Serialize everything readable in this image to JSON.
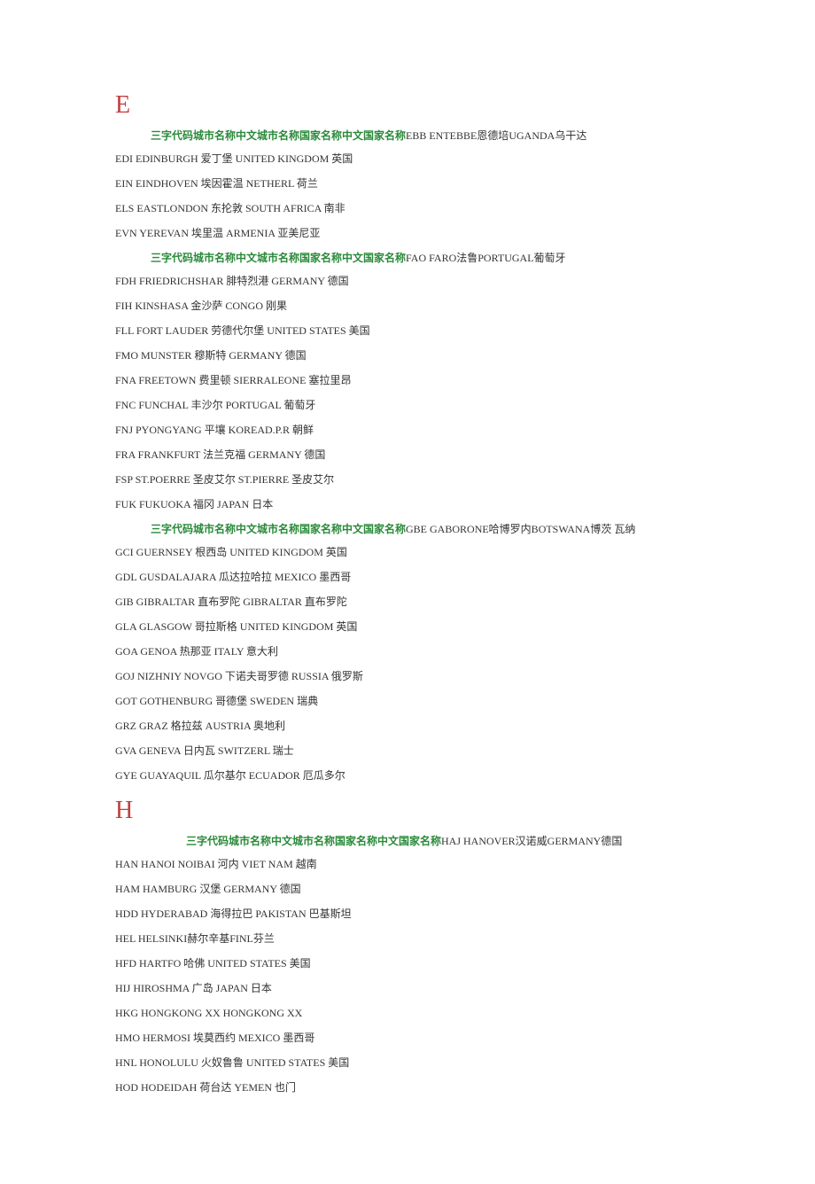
{
  "sections": [
    {
      "letter": "E",
      "header": {
        "green": "三字代码城市名称中文城市名称国家名称中文国家名称",
        "tail": "EBB ENTEBBE恩德培UGANDA乌干达"
      },
      "entries": [
        "EDI EDINBURGH 爱丁堡 UNITED KINGDOM 英国",
        "EIN EINDHOVEN 埃因霍温 NETHERL 荷兰",
        "ELS EASTLONDON 东抡敦 SOUTH AFRICA 南非",
        "EVN YEREVAN 埃里温 ARMENIA 亚美尼亚"
      ]
    },
    {
      "letter": "",
      "header": {
        "green": "三字代码城市名称中文城市名称国家名称中文国家名称",
        "tail": "FAO FARO法鲁PORTUGAL葡萄牙"
      },
      "entries": [
        "FDH FRIEDRICHSHAR 腓特烈港 GERMANY 德国",
        "FIH KINSHASA 金沙萨 CONGO 刚果",
        "FLL FORT LAUDER 劳德代尔堡 UNITED STATES 美国",
        "FMO MUNSTER 穆斯特 GERMANY 德国",
        "FNA FREETOWN 费里顿 SIERRALEONE 塞拉里昂",
        "FNC FUNCHAL 丰沙尔 PORTUGAL 葡萄牙",
        "FNJ PYONGYANG 平壤 KOREAD.P.R 朝鲜",
        "FRA FRANKFURT 法兰克福 GERMANY 德国",
        "FSP ST.POERRE 圣皮艾尔 ST.PIERRE 圣皮艾尔",
        "FUK FUKUOKA 福冈 JAPAN 日本"
      ]
    },
    {
      "letter": "",
      "header": {
        "green": "三字代码城市名称中文城市名称国家名称中文国家名称",
        "tail": "GBE GABORONE哈博罗内BOTSWANA博茨 瓦纳"
      },
      "entries": [
        "GCI GUERNSEY 根西岛 UNITED KINGDOM 英国",
        "GDL GUSDALAJARA 瓜达拉哈拉 MEXICO 墨西哥",
        "GIB GIBRALTAR 直布罗陀 GIBRALTAR 直布罗陀",
        "GLA GLASGOW 哥拉斯格 UNITED KINGDOM 英国",
        "GOA GENOA 热那亚 ITALY 意大利",
        "GOJ NIZHNIY NOVGO 下诺夫哥罗德 RUSSIA 俄罗斯",
        "GOT GOTHENBURG 哥德堡 SWEDEN 瑞典",
        "GRZ GRAZ 格拉兹 AUSTRIA 奥地利",
        "GVA GENEVA 日内瓦 SWITZERL 瑞士",
        "GYE GUAYAQUIL 瓜尔基尔 ECUADOR 厄瓜多尔"
      ]
    },
    {
      "letter": "H",
      "header": {
        "green": "三字代码城市名称中文城市名称国家名称中文国家名称",
        "tail": "HAJ HANOVER汉诺威GERMANY德国"
      },
      "header_indent": true,
      "entries": [
        "HAN HANOI NOIBAI 河内 VIET NAM 越南",
        "HAM HAMBURG 汉堡 GERMANY 德国",
        "HDD HYDERABAD 海得拉巴 PAKISTAN 巴基斯坦",
        "HEL HELSINKI赫尔辛基FINL芬兰",
        "HFD HARTFO 哈佛 UNITED STATES 美国",
        "HIJ HIROSHMA 广岛 JAPAN 日本",
        "HKG HONGKONG XX HONGKONG XX",
        "HMO HERMOSI 埃莫西约 MEXICO 墨西哥",
        "HNL HONOLULU 火奴鲁鲁 UNITED STATES 美国",
        "HOD HODEIDAH 荷台达 YEMEN 也门"
      ]
    }
  ]
}
